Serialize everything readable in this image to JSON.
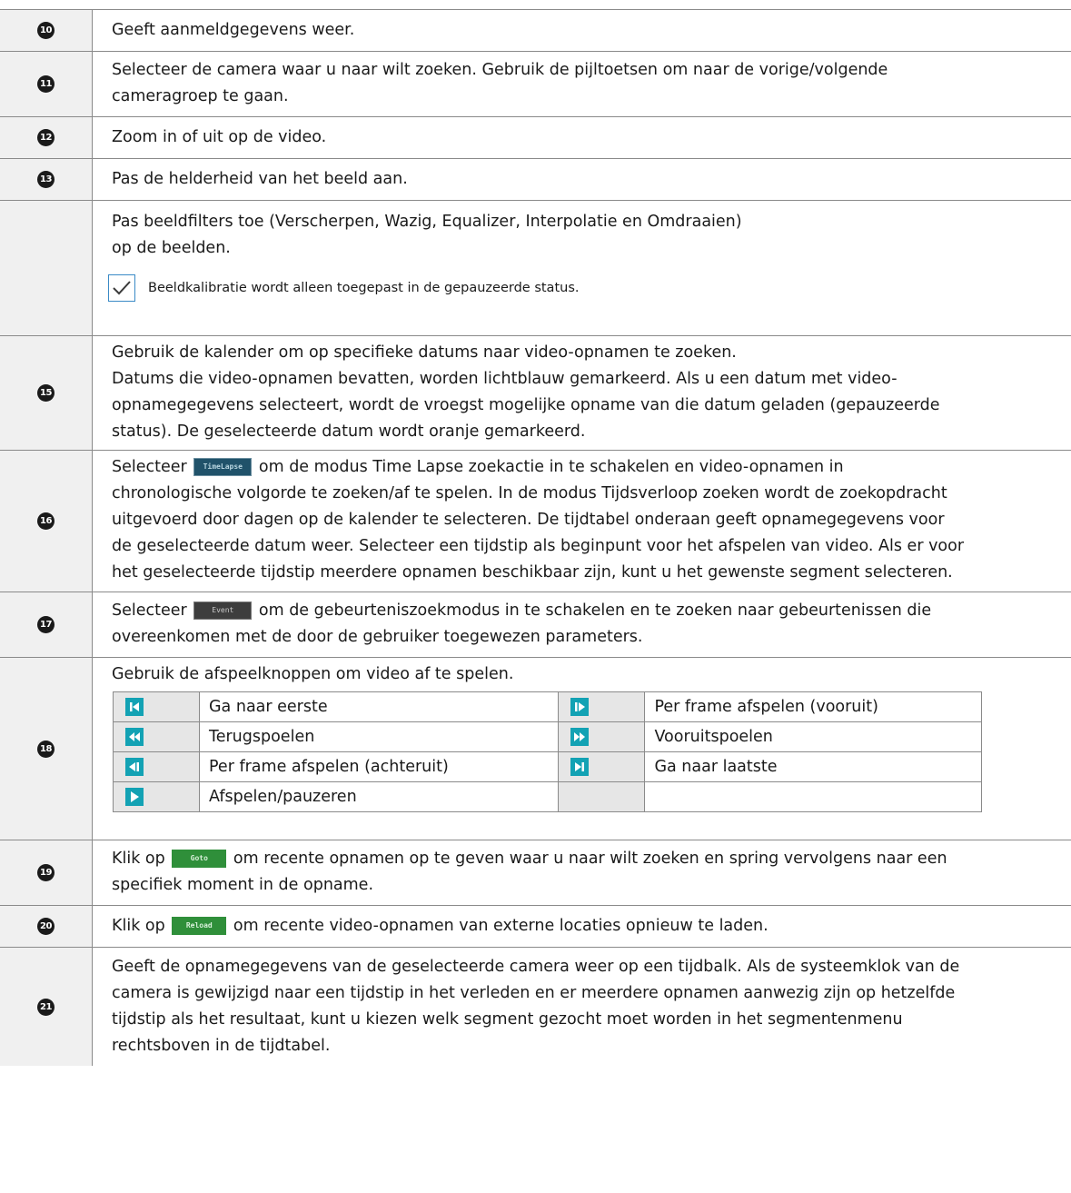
{
  "rows": [
    {
      "num": "10",
      "text": "Geeft aanmeldgegevens weer."
    },
    {
      "num": "11",
      "lines": [
        "Selecteer de camera waar u naar wilt zoeken. Gebruik de pijltoetsen om naar de vorige/volgende",
        "cameragroep te gaan."
      ]
    },
    {
      "num": "12",
      "text": "Zoom in of uit op de video."
    },
    {
      "num": "13",
      "text": "Pas de helderheid van het beeld aan."
    },
    {
      "num": "",
      "lines": [
        "Pas beeldfilters toe (Verscherpen, Wazig, Equalizer, Interpolatie en Omdraaien)",
        "op de beelden."
      ],
      "note": "Beeldkalibratie wordt alleen toegepast in de gepauzeerde status."
    },
    {
      "num": "15",
      "lines": [
        "Gebruik de kalender om op specifieke datums naar video-opnamen te zoeken.",
        "Datums die video-opnamen bevatten, worden lichtblauw gemarkeerd. Als u een datum met video-",
        "opnamegegevens selecteert, wordt de vroegst mogelijke opname van die datum geladen (gepauzeerde",
        "status). De geselecteerde datum wordt oranje gemarkeerd."
      ]
    },
    {
      "num": "16",
      "btn": "TimeLapse",
      "pre": "Selecteer",
      "post": "om de modus Time Lapse zoekactie in te schakelen en video-opnamen in",
      "lines": [
        "chronologische volgorde te zoeken/af te spelen. In de modus Tijdsverloop zoeken wordt de zoekopdracht",
        "uitgevoerd door dagen op de kalender te selecteren. De tijdtabel onderaan geeft opnamegegevens voor",
        "de geselecteerde datum weer. Selecteer een tijdstip als beginpunt voor het afspelen van video. Als er voor",
        "het geselecteerde tijdstip meerdere opnamen beschikbaar zijn, kunt u het gewenste segment selecteren."
      ]
    },
    {
      "num": "17",
      "btn": "Event",
      "pre": "Selecteer",
      "post": "om de gebeurteniszoekmodus in te schakelen en te zoeken naar gebeurtenissen die",
      "lines": [
        "overeenkomen met de door de gebruiker toegewezen parameters."
      ]
    },
    {
      "num": "18",
      "text": "Gebruik de afspeelknoppen om video af te spelen.",
      "controls": [
        [
          "Ga naar eerste",
          "Per frame afspelen (vooruit)"
        ],
        [
          "Terugspoelen",
          "Vooruitspoelen"
        ],
        [
          "Per frame afspelen (achteruit)",
          "Ga naar laatste"
        ],
        [
          "Afspelen/pauzeren",
          ""
        ]
      ]
    },
    {
      "num": "19",
      "btn": "Goto",
      "pre": "Klik op",
      "post": "om recente opnamen op te geven waar u naar wilt zoeken en spring vervolgens naar een",
      "lines": [
        "specifiek moment in de opname."
      ]
    },
    {
      "num": "20",
      "btn": "Reload",
      "pre": "Klik op",
      "post": "om recente video-opnamen van externe locaties opnieuw te laden."
    },
    {
      "num": "21",
      "lines": [
        "Geeft de opnamegegevens van de geselecteerde camera weer op een tijdbalk. Als de systeemklok van de",
        "camera is gewijzigd naar een tijdstip in het verleden en er meerdere opnamen aanwezig zijn op hetzelfde",
        "tijdstip als het resultaat, kunt u kiezen welk segment gezocht moet worden in het segmentenmenu",
        "rechtsboven in de tijdtabel."
      ]
    }
  ]
}
